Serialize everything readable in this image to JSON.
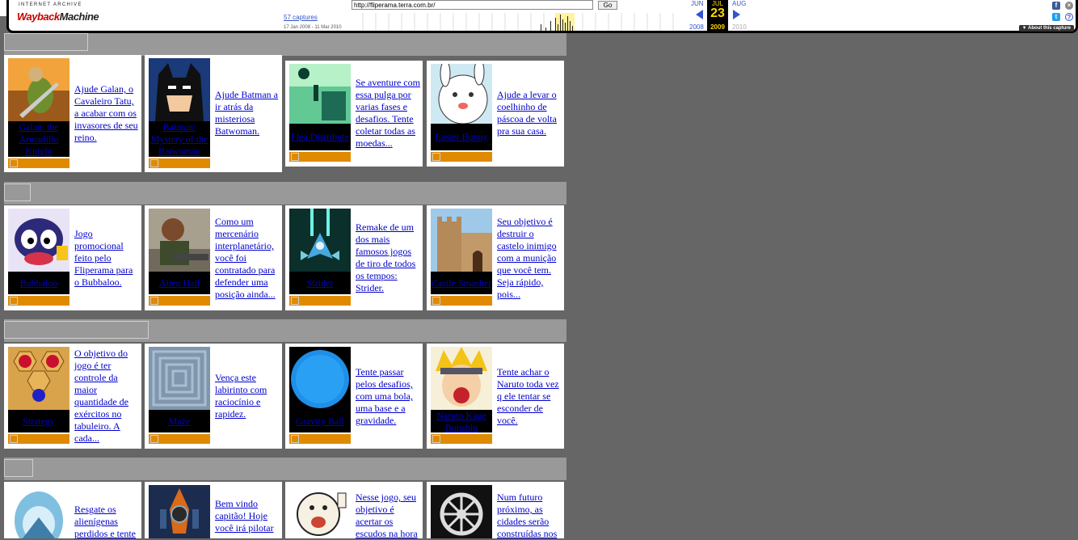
{
  "wayback": {
    "logo_top": "INTERNET ARCHIVE",
    "logo_main_a": "Wayback",
    "logo_main_b": "Machine",
    "url": "http://fliperama.terra.com.br/",
    "go": "Go",
    "captures": "57 captures",
    "range": "17 Jan 2008 - 11 Mar 2010",
    "months": {
      "prev": "JUN",
      "cur": "JUL",
      "next": "AUG"
    },
    "day": "23",
    "years": {
      "prev": "2008",
      "cur": "2009",
      "next": "2010"
    },
    "about": "About this capture",
    "accent": "#ffd700"
  },
  "games": [
    {
      "name": "Galan, the Armadillo Knight",
      "desc": "Ajude Galan, o Cavaleiro Tatu, a acabar com os invasores de seu reino."
    },
    {
      "name": "Batman: Mystery of the Batwoman",
      "desc": "Ajude Batman a ir atrás da misteriosa Batwoman."
    },
    {
      "name": "Flea Distribute",
      "desc": "Se aventure com essa pulga por varias fases e desafios. Tente coletar todas as moedas..."
    },
    {
      "name": "Easter Bunny",
      "desc": "Ajude a levar o coelhinho de páscoa de volta pra sua casa."
    },
    {
      "name": "Bubbaloo",
      "desc": "Jogo promocional feito pelo Fliperama para o Bubbaloo."
    },
    {
      "name": "Alien Hall",
      "desc": "Como um mercenário interplanetário, você foi contratado para defender uma posição ainda..."
    },
    {
      "name": "Strider",
      "desc": "Remake de um dos mais famosos jogos de tiro de todos os tempos: Strider."
    },
    {
      "name": "Castle Smasher",
      "desc": "Seu objetivo é destruir o castelo inimigo com a munição que você tem. Seja rápido, pois..."
    },
    {
      "name": "Strategy",
      "desc": "O objetivo do jogo é ter controle da maior quantidade de exércitos no tabuleiro. A cada..."
    },
    {
      "name": "Maze",
      "desc": "Vença este labirinto com raciocínio e rapidez."
    },
    {
      "name": "Gravity Ball",
      "desc": "Tente passar pelos desafios, com uma bola, uma base e a gravidade."
    },
    {
      "name": "Naruto Kage Bunshin",
      "desc": "Tente achar o Naruto toda vez q ele tentar se esconder de você."
    },
    {
      "name": "",
      "desc": "Resgate os alienígenas perdidos e tente"
    },
    {
      "name": "",
      "desc": "Bem vindo capitão! Hoje você irá pilotar"
    },
    {
      "name": "",
      "desc": "Nesse jogo, seu objetivo é acertar os escudos na hora"
    },
    {
      "name": "",
      "desc": "Num futuro próximo, as cidades serão construídas nos"
    }
  ]
}
